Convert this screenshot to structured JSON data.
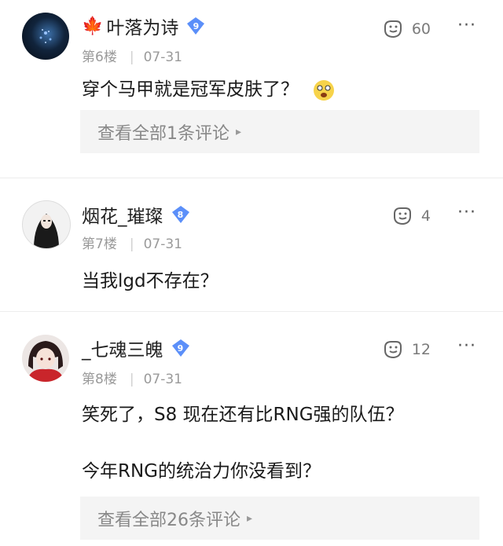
{
  "comments": [
    {
      "username": "叶落为诗",
      "level": "9",
      "floor": "第6楼",
      "date": "07-31",
      "likes": "60",
      "text": "穿个马甲就是冠军皮肤了？",
      "replies_link": "查看全部1条评论"
    },
    {
      "username": "烟花_璀璨",
      "level": "8",
      "floor": "第7楼",
      "date": "07-31",
      "likes": "4",
      "text": "当我lgd不存在？"
    },
    {
      "username": "_七魂三魄",
      "level": "9",
      "floor": "第8楼",
      "date": "07-31",
      "likes": "12",
      "text_line1": "笑死了，S8 现在还有比RNG强的队伍？",
      "text_line2": "今年RNG的统治力你没看到？",
      "replies_link": "查看全部26条评论"
    }
  ],
  "colors": {
    "level_badge": "#5b8ff9",
    "meta": "#9a9a9a",
    "reply_bg": "#f4f4f4"
  },
  "icons": {
    "like": "thumb-up-face-icon",
    "more": "more-dots-icon",
    "leaf": "maple-leaf-icon"
  }
}
